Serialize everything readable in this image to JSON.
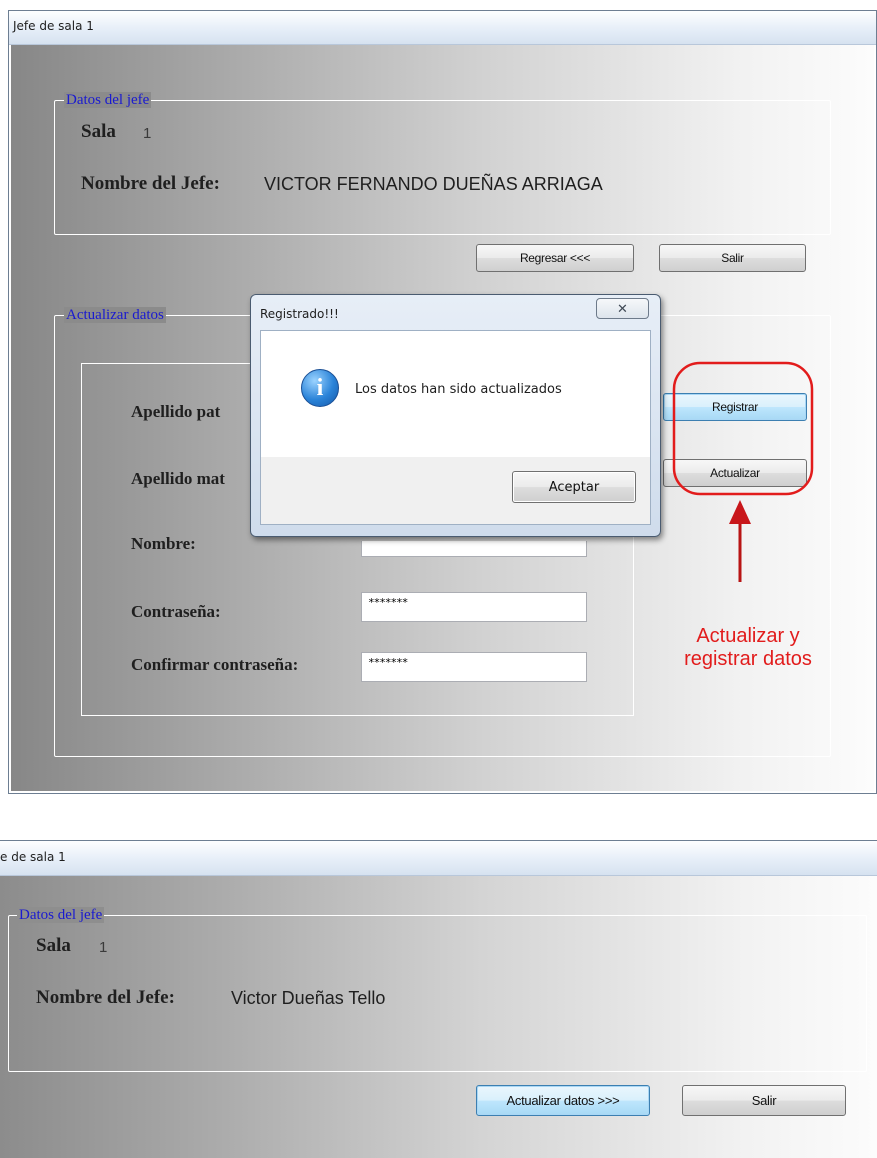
{
  "window1": {
    "title": "Jefe de sala 1",
    "datos_group_title": "Datos del jefe",
    "sala_label": "Sala",
    "sala_value": "1",
    "nombre_jefe_label": "Nombre del Jefe:",
    "nombre_jefe_value": "VICTOR FERNANDO DUEÑAS ARRIAGA",
    "regresar_button": "Regresar <<<",
    "salir_button": "Salir",
    "actualizar_group_title": "Actualizar datos",
    "apellido_paterno_label": "Apellido pat",
    "apellido_materno_label": "Apellido mat",
    "nombre_label": "Nombre:",
    "contrasena_label": "Contraseña:",
    "confirmar_label": "Confirmar contraseña:",
    "contrasena_value": "*******",
    "confirmar_value": "*******",
    "registrar_button": "Registrar",
    "actualizar_button": "Actualizar"
  },
  "dialog": {
    "title": "Registrado!!!",
    "close_glyph": "✕",
    "icon": "info-icon",
    "message": "Los datos han sido actualizados",
    "ok_button": "Aceptar"
  },
  "annotation": {
    "line1": "Actualizar y",
    "line2": "registrar datos",
    "color": "#e21c1c"
  },
  "window2": {
    "title": "e de sala 1",
    "datos_group_title": "Datos del jefe",
    "sala_label": "Sala",
    "sala_value": "1",
    "nombre_jefe_label": "Nombre del Jefe:",
    "nombre_jefe_value": "Victor Dueñas Tello",
    "actualizar_datos_button": "Actualizar datos >>>",
    "salir_button": "Salir"
  }
}
